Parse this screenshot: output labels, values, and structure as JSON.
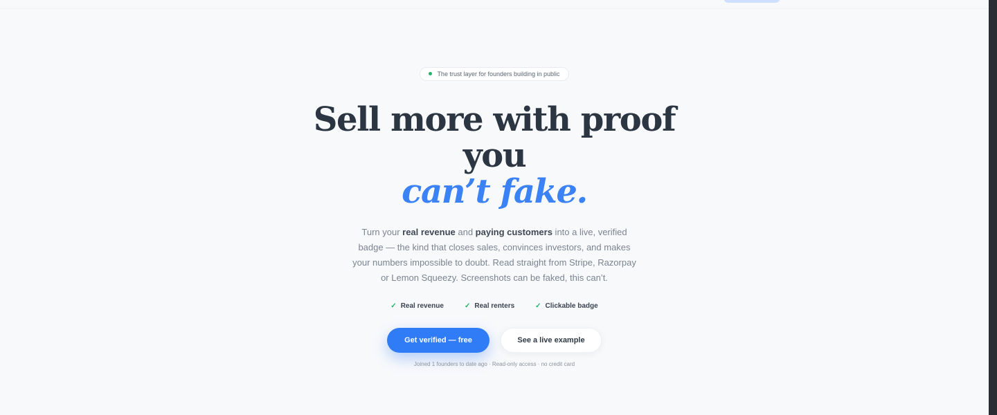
{
  "hero": {
    "eyebrow": "The trust layer for founders building in public",
    "headline_line1": "Sell more with proof",
    "headline_line2": "you",
    "headline_accent": "can’t fake.",
    "subtext": {
      "t1": "Turn your ",
      "b1": "real revenue",
      "t2": " and ",
      "b2": "paying customers",
      "t3": " into a live, verified badge — the kind that closes sales, convinces investors, and makes your numbers impossible to doubt. Read straight from Stripe, Razorpay or Lemon Squeezy. Screenshots can be faked, this can’t."
    },
    "features": [
      {
        "label": "Real revenue"
      },
      {
        "label": "Real renters"
      },
      {
        "label": "Clickable badge"
      }
    ],
    "cta_primary": "Get verified — free",
    "cta_secondary": "See a live example",
    "fineprint": "Joined 1 founders to date ago · Read-only access · no credit card"
  },
  "colors": {
    "accent": "#3b82f6",
    "primary_button": "#2f7cf6",
    "check": "#23b26b",
    "background": "#f8f9fb",
    "headline": "#2c3642"
  },
  "icons": {
    "eyebrow_dot": "status-dot-icon",
    "feature_check": "check-icon"
  }
}
